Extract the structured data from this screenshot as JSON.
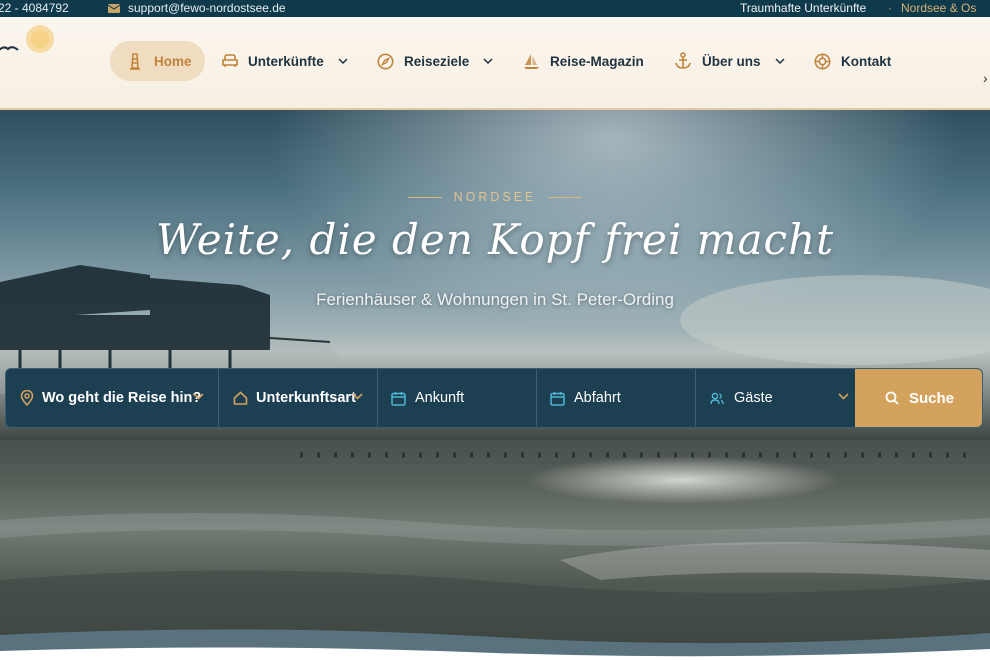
{
  "topbar": {
    "phone": "22 - 4084792",
    "email": "support@fewo-nordostsee.de",
    "tagline": "Traumhafte Unterkünfte",
    "separator": "·",
    "regions": "Nordsee & Os"
  },
  "nav": {
    "items": [
      {
        "label": "Home",
        "icon": "lighthouse-icon",
        "active": true
      },
      {
        "label": "Unterkünfte",
        "icon": "armchair-icon",
        "dropdown": true
      },
      {
        "label": "Reiseziele",
        "icon": "compass-icon",
        "dropdown": true
      },
      {
        "label": "Reise-Magazin",
        "icon": "sailboat-icon"
      },
      {
        "label": "Über uns",
        "icon": "anchor-icon",
        "dropdown": true
      },
      {
        "label": "Kontakt",
        "icon": "lifebuoy-icon"
      }
    ]
  },
  "hero": {
    "overline": "NORDSEE",
    "headline": "Weite, die den Kopf frei macht",
    "subline": "Ferienhäuser & Wohnungen in St. Peter-Ording"
  },
  "search": {
    "destination": "Wo geht die Reise hin?",
    "type": "Unterkunftsart",
    "arrival": "Ankunft",
    "departure": "Abfahrt",
    "guests": "Gäste",
    "button": "Suche"
  },
  "colors": {
    "accent": "#d3a25c",
    "dark": "#0f3a4c",
    "nav_active_bg": "#f0dcc0"
  }
}
